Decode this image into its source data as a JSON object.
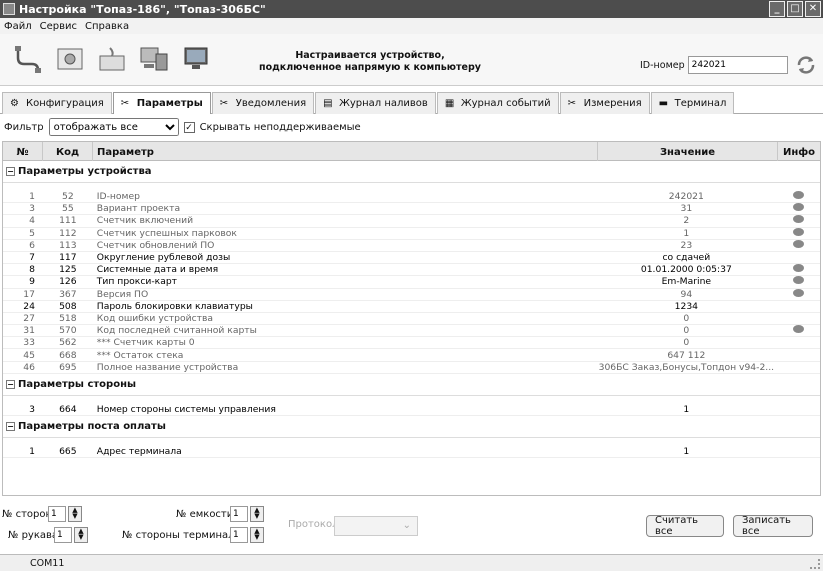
{
  "window": {
    "title": "Настройка \"Топаз-186\", \"Топаз-306БС\""
  },
  "menu": [
    "Файл",
    "Сервис",
    "Справка"
  ],
  "toolbar": {
    "center_line1": "Настраивается устройство,",
    "center_line2": "подключенное напрямую к компьютеру",
    "id_label": "ID-номер",
    "id_value": "242021",
    "icons": [
      "cable-icon",
      "settings-chip-icon",
      "device-icon",
      "computer-icon",
      "monitor-icon",
      "refresh-icon"
    ]
  },
  "tabs": [
    {
      "label": "Конфигурация",
      "icon": "config-icon",
      "active": false
    },
    {
      "label": "Параметры",
      "icon": "params-icon",
      "active": true
    },
    {
      "label": "Уведомления",
      "icon": "notify-icon",
      "active": false
    },
    {
      "label": "Журнал наливов",
      "icon": "log-icon",
      "active": false
    },
    {
      "label": "Журнал событий",
      "icon": "events-icon",
      "active": false
    },
    {
      "label": "Измерения",
      "icon": "measure-icon",
      "active": false
    },
    {
      "label": "Терминал",
      "icon": "terminal-icon",
      "active": false
    }
  ],
  "filter": {
    "label": "Фильтр",
    "selected": "отображать все",
    "checkbox_label": "Скрывать неподдерживаемые",
    "checkbox_checked": true
  },
  "columns": {
    "n": "№",
    "code": "Код",
    "param": "Параметр",
    "value": "Значение",
    "info": "Инфо"
  },
  "sections": [
    {
      "title": "Параметры устройства",
      "rows": [
        {
          "n": "1",
          "code": "52",
          "param": "ID-номер",
          "value": "242021",
          "info": true,
          "dim": true
        },
        {
          "n": "3",
          "code": "55",
          "param": "Вариант проекта",
          "value": "31",
          "info": true,
          "dim": true
        },
        {
          "n": "4",
          "code": "111",
          "param": "Счетчик включений",
          "value": "2",
          "info": true,
          "dim": true
        },
        {
          "n": "5",
          "code": "112",
          "param": "Счетчик успешных парковок",
          "value": "1",
          "info": true,
          "dim": true
        },
        {
          "n": "6",
          "code": "113",
          "param": "Счетчик обновлений ПО",
          "value": "23",
          "info": true,
          "dim": true
        },
        {
          "n": "7",
          "code": "117",
          "param": "Округление рублевой дозы",
          "value": "со сдачей",
          "info": false,
          "dim": false
        },
        {
          "n": "8",
          "code": "125",
          "param": "Системные дата и время",
          "value": "01.01.2000 0:05:37",
          "info": true,
          "dim": false
        },
        {
          "n": "9",
          "code": "126",
          "param": "Тип прокси-карт",
          "value": "Em-Marine",
          "info": true,
          "dim": false
        },
        {
          "n": "17",
          "code": "367",
          "param": "Версия ПО",
          "value": "94",
          "info": true,
          "dim": true
        },
        {
          "n": "24",
          "code": "508",
          "param": "Пароль блокировки клавиатуры",
          "value": "1234",
          "info": false,
          "dim": false
        },
        {
          "n": "27",
          "code": "518",
          "param": "Код ошибки устройства",
          "value": "0",
          "info": false,
          "dim": true
        },
        {
          "n": "31",
          "code": "570",
          "param": "Код последней считанной карты",
          "value": "0",
          "info": true,
          "dim": true
        },
        {
          "n": "33",
          "code": "562",
          "param": "*** Счетчик карты 0",
          "value": "0",
          "info": false,
          "dim": true
        },
        {
          "n": "45",
          "code": "668",
          "param": "*** Остаток стека",
          "value": "647 112",
          "info": false,
          "dim": true
        },
        {
          "n": "46",
          "code": "695",
          "param": "Полное название устройства",
          "value": "306БС Заказ,Бонусы,Топдон v94-2...",
          "info": false,
          "dim": true
        }
      ]
    },
    {
      "title": "Параметры стороны",
      "rows": [
        {
          "n": "3",
          "code": "664",
          "param": "Номер стороны системы управления",
          "value": "1",
          "info": false,
          "dim": false
        }
      ]
    },
    {
      "title": "Параметры поста оплаты",
      "rows": [
        {
          "n": "1",
          "code": "665",
          "param": "Адрес терминала",
          "value": "1",
          "info": false,
          "dim": false
        }
      ]
    }
  ],
  "bottom": {
    "side_label": "№ стороны",
    "side_value": "1",
    "tank_label": "№ емкости",
    "tank_value": "1",
    "hose_label": "№ рукава",
    "hose_value": "1",
    "term_side_label": "№ стороны терминала",
    "term_side_value": "1",
    "protocol_label": "Протокол",
    "read_all": "Считать все",
    "write_all": "Записать все"
  },
  "status": {
    "port": "COM11"
  }
}
